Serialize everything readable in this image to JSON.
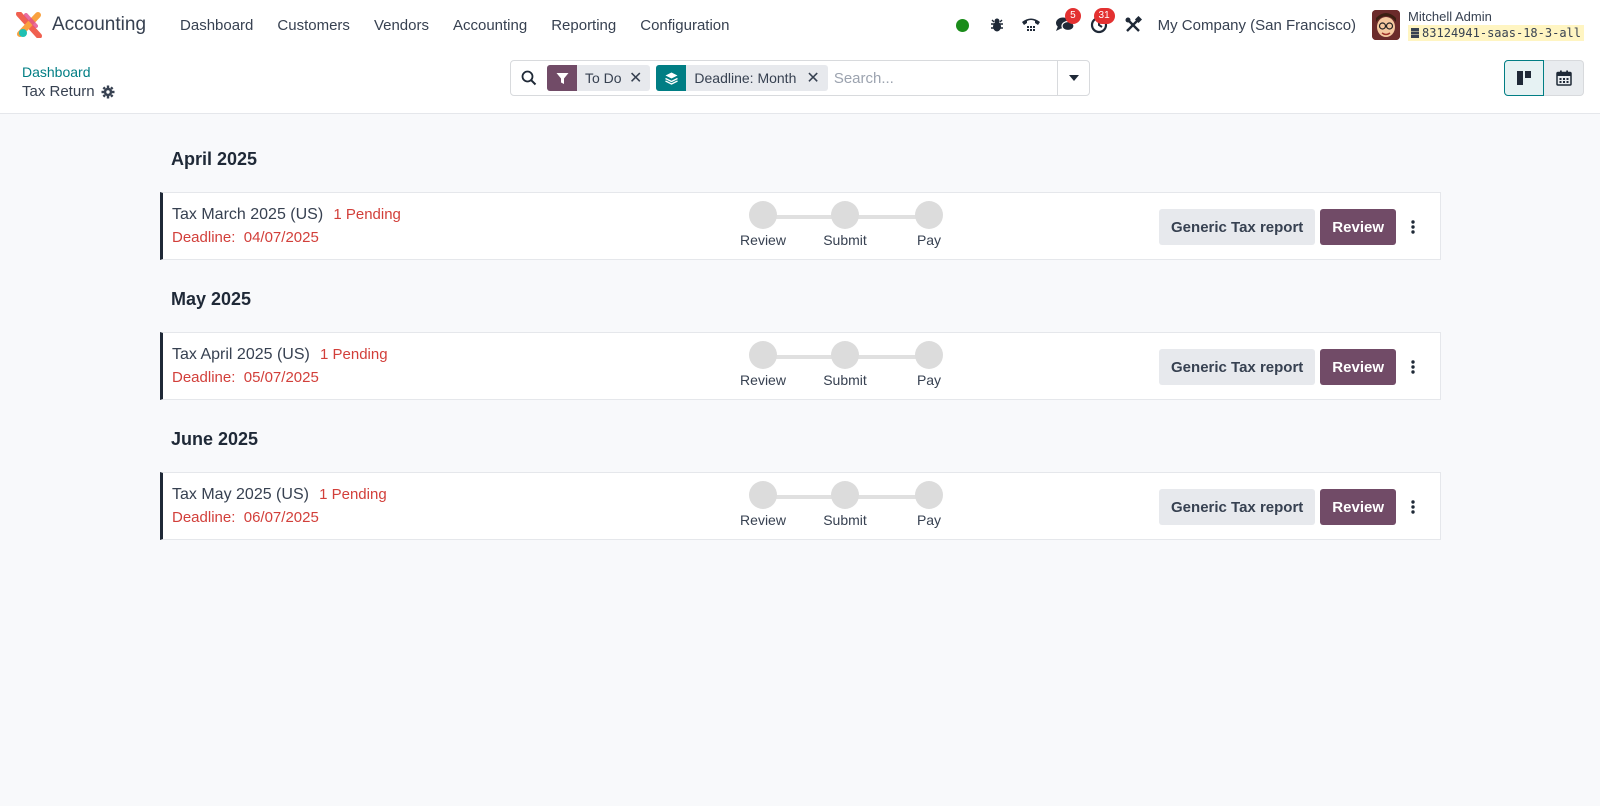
{
  "app": {
    "title": "Accounting"
  },
  "nav": {
    "items": [
      "Dashboard",
      "Customers",
      "Vendors",
      "Accounting",
      "Reporting",
      "Configuration"
    ]
  },
  "systray": {
    "messages_badge": "5",
    "activities_badge": "31",
    "company": "My Company (San Francisco)",
    "user_name": "Mitchell Admin",
    "db_name": "83124941-saas-18-3-all"
  },
  "breadcrumb": {
    "parent": "Dashboard",
    "current": "Tax Return"
  },
  "search": {
    "placeholder": "Search...",
    "facets": [
      {
        "icon": "filter-icon",
        "label": "To Do"
      },
      {
        "icon": "layers-icon",
        "label": "Deadline: Month"
      }
    ]
  },
  "groups": [
    {
      "header": "April 2025",
      "cards": [
        {
          "title": "Tax March 2025 (US)",
          "pending": "1 Pending",
          "deadline_label": "Deadline:",
          "deadline": "04/07/2025",
          "steps": [
            "Review",
            "Submit",
            "Pay"
          ],
          "report_button": "Generic Tax report",
          "action_button": "Review"
        }
      ]
    },
    {
      "header": "May 2025",
      "cards": [
        {
          "title": "Tax April 2025 (US)",
          "pending": "1 Pending",
          "deadline_label": "Deadline:",
          "deadline": "05/07/2025",
          "steps": [
            "Review",
            "Submit",
            "Pay"
          ],
          "report_button": "Generic Tax report",
          "action_button": "Review"
        }
      ]
    },
    {
      "header": "June 2025",
      "cards": [
        {
          "title": "Tax May 2025 (US)",
          "pending": "1 Pending",
          "deadline_label": "Deadline:",
          "deadline": "06/07/2025",
          "steps": [
            "Review",
            "Submit",
            "Pay"
          ],
          "report_button": "Generic Tax report",
          "action_button": "Review"
        }
      ]
    }
  ],
  "colors": {
    "brand": "#714b67",
    "link": "#017e84",
    "danger": "#d23f3a",
    "online": "#1a8c1a"
  }
}
